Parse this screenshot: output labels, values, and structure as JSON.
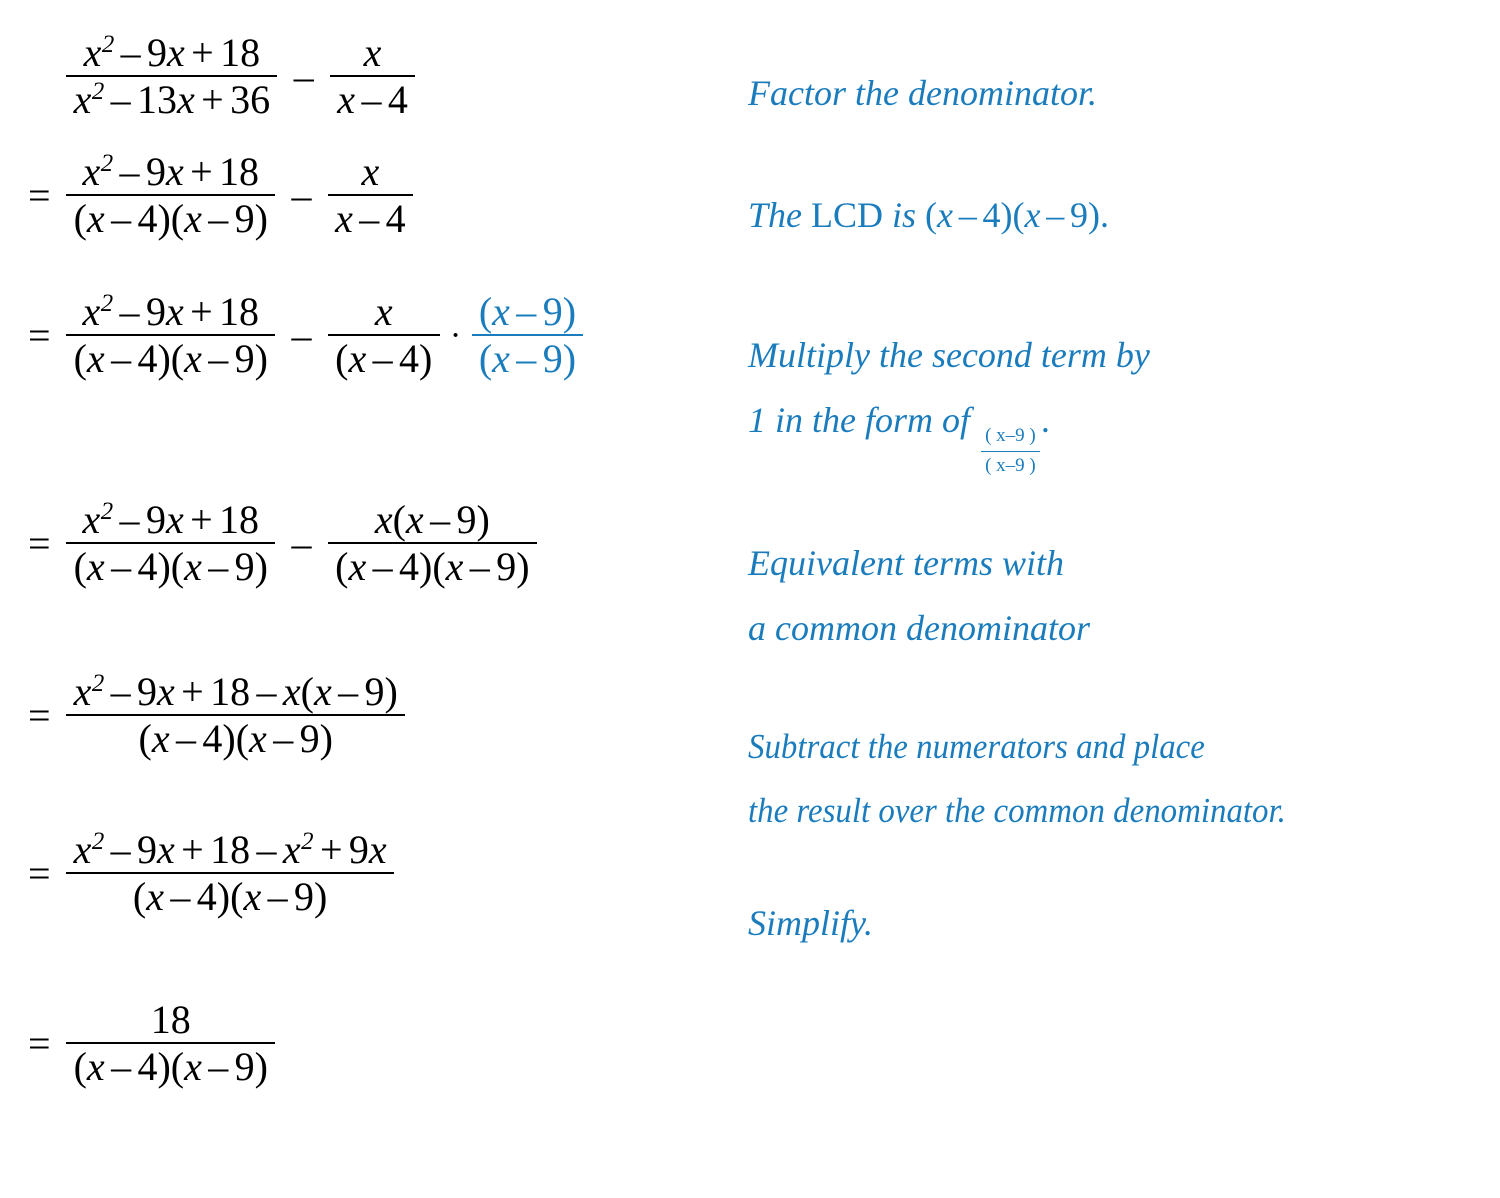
{
  "document": {
    "type": "algebra-worked-example",
    "topic": "Subtracting rational expressions with unlike denominators",
    "accent_color": "#1a7cbd",
    "text_color": "#000000",
    "background_color": "#ffffff"
  },
  "symbols": {
    "equals": "=",
    "minus": "–",
    "plus": "+",
    "times_dot": "·",
    "lparen": "(",
    "rparen": ")",
    "x": "x",
    "exponent_two": "2",
    "period": "."
  },
  "steps": [
    {
      "id": "step-1",
      "equals": "",
      "left_fraction": {
        "numerator": "x² – 9x + 18",
        "denominator": "x² – 13x + 36"
      },
      "operator": "–",
      "right_fraction": {
        "numerator": "x",
        "denominator": "x – 4"
      },
      "annotation": "Factor the denominator."
    },
    {
      "id": "step-2",
      "equals": "=",
      "left_fraction": {
        "numerator": "x² – 9x + 18",
        "denominator": "(x – 4)(x – 9)"
      },
      "operator": "–",
      "right_fraction": {
        "numerator": "x",
        "denominator": "x – 4"
      },
      "annotation": "The LCD is (x – 4)(x – 9)."
    },
    {
      "id": "step-3",
      "equals": "=",
      "left_fraction": {
        "numerator": "x² – 9x + 18",
        "denominator": "(x – 4)(x – 9)"
      },
      "operator": "–",
      "right_fraction": {
        "numerator": "x",
        "denominator": "(x – 4)"
      },
      "multiply_dot": "·",
      "blue_fraction": {
        "numerator": "(x – 9)",
        "denominator": "(x – 9)"
      },
      "annotation": "Multiply the second term by 1 in the form of (x–9)/(x–9)."
    },
    {
      "id": "step-4",
      "equals": "=",
      "left_fraction": {
        "numerator": "x² – 9x + 18",
        "denominator": "(x – 4)(x – 9)"
      },
      "operator": "–",
      "right_fraction": {
        "numerator": "x(x – 9)",
        "denominator": "(x – 4)(x – 9)"
      },
      "annotation": "Equivalent terms with a common denominator"
    },
    {
      "id": "step-5",
      "equals": "=",
      "single_fraction": {
        "numerator": "x² – 9x + 18 – x(x – 9)",
        "denominator": "(x – 4)(x – 9)"
      },
      "annotation": "Subtract the numerators and place the result over the common denominator."
    },
    {
      "id": "step-6",
      "equals": "=",
      "single_fraction": {
        "numerator": "x² – 9x + 18 – x² + 9x",
        "denominator": "(x – 4)(x – 9)"
      },
      "annotation": "Simplify."
    },
    {
      "id": "step-7",
      "equals": "=",
      "single_fraction": {
        "numerator": "18",
        "denominator": "(x – 4)(x – 9)"
      },
      "annotation": ""
    }
  ],
  "annotations": [
    {
      "id": "annotation-factor",
      "lines": [
        "Factor the denominator."
      ],
      "aligned_step": "step-1"
    },
    {
      "id": "annotation-lcd",
      "prefix": "The ",
      "upright": "LCD",
      "middle": " is ",
      "expression": "(x – 4)(x – 9).",
      "aligned_step": "step-2"
    },
    {
      "id": "annotation-multiply",
      "line1": "Multiply the second term by",
      "line2_prefix": "1 in the form of ",
      "fraction_numerator": "( x–9 )",
      "fraction_denominator": "( x–9 )",
      "line2_suffix": ".",
      "aligned_step": "step-3"
    },
    {
      "id": "annotation-equivalent",
      "line1": "Equivalent terms with",
      "line2": "a common denominator",
      "aligned_step": "step-4"
    },
    {
      "id": "annotation-subtract",
      "line1": "Subtract the numerators and place",
      "line2": "the result over the common denominator.",
      "aligned_step": "step-5"
    },
    {
      "id": "annotation-simplify",
      "lines": [
        "Simplify."
      ],
      "aligned_step": "step-6"
    }
  ],
  "math_parts": {
    "x2_9x_18": {
      "x": "x",
      "exp": "2",
      "minus": "–",
      "nine_x": "9x",
      "plus": "+",
      "eighteen": "18"
    },
    "x2_13x_36": {
      "x": "x",
      "exp": "2",
      "minus": "–",
      "thirteen_x": "13x",
      "plus": "+",
      "thirtysix": "36"
    },
    "x_minus_4": "x – 4",
    "x_minus_9": "x – 9",
    "factored_lcd": "(x – 4)(x – 9)",
    "just_x": "x",
    "eighteen": "18",
    "nine_x": "9x",
    "x_times_x_minus_9": "x(x – 9)"
  }
}
